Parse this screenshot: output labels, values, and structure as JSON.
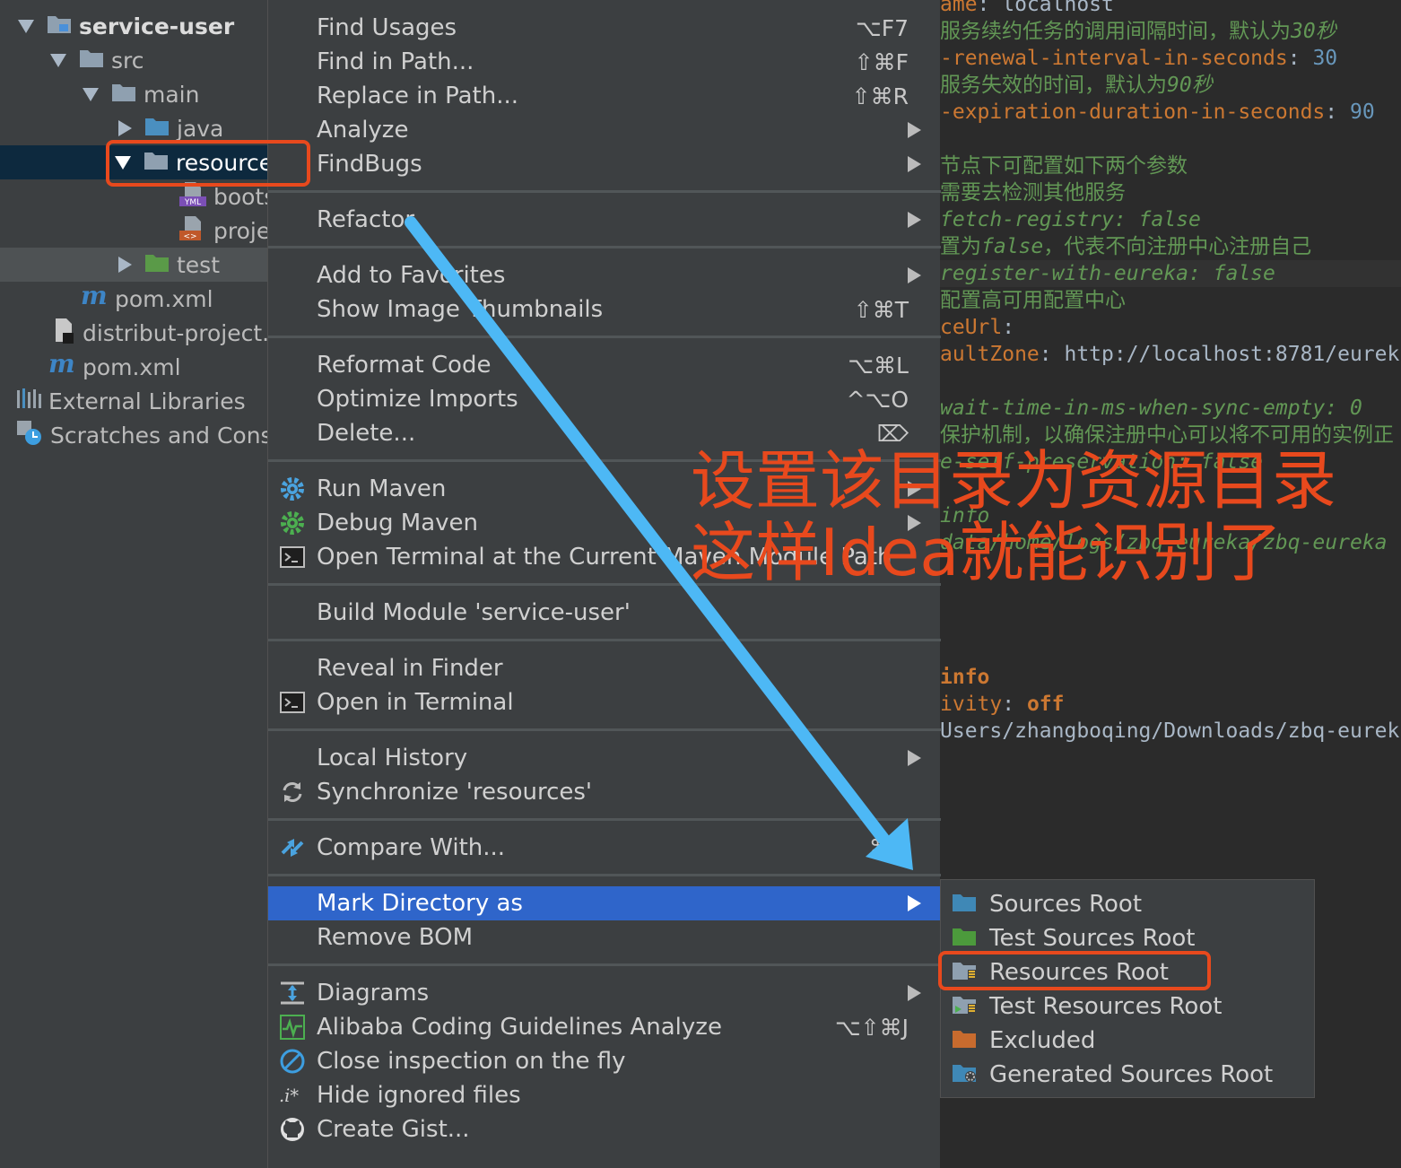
{
  "tree": {
    "items": [
      {
        "label": "service-user",
        "icon": "module-folder-icon"
      },
      {
        "label": "src",
        "icon": "folder-icon"
      },
      {
        "label": "main",
        "icon": "folder-icon"
      },
      {
        "label": "java",
        "icon": "source-folder-icon"
      },
      {
        "label": "resource",
        "icon": "folder-icon"
      },
      {
        "label": "boots",
        "icon": "yml-file-icon"
      },
      {
        "label": "proje",
        "icon": "properties-file-icon"
      },
      {
        "label": "test",
        "icon": "test-folder-icon"
      },
      {
        "label": "pom.xml",
        "icon": "maven-icon"
      },
      {
        "label": "distribut-project.",
        "icon": "file-icon"
      },
      {
        "label": "pom.xml",
        "icon": "maven-icon"
      },
      {
        "label": "External Libraries",
        "icon": "libraries-icon"
      },
      {
        "label": "Scratches and Cons",
        "icon": "scratches-icon"
      }
    ]
  },
  "editor": {
    "lines": [
      {
        "parts": [
          {
            "t": "ame",
            "c": "key"
          },
          {
            "t": ": localhost",
            "c": "plain"
          }
        ]
      },
      {
        "parts": [
          {
            "t": "服务续约任务的调用间隔时间，默认为",
            "c": "cmz"
          },
          {
            "t": "30秒",
            "c": "cm"
          }
        ]
      },
      {
        "parts": [
          {
            "t": "-renewal-interval-in-seconds",
            "c": "key"
          },
          {
            "t": ": ",
            "c": "plain"
          },
          {
            "t": "30",
            "c": "num"
          }
        ]
      },
      {
        "parts": [
          {
            "t": "服务失效的时间，默认为",
            "c": "cmz"
          },
          {
            "t": "90秒",
            "c": "cm"
          }
        ]
      },
      {
        "parts": [
          {
            "t": "-expiration-duration-in-seconds",
            "c": "key"
          },
          {
            "t": ": ",
            "c": "plain"
          },
          {
            "t": "90",
            "c": "num"
          }
        ]
      },
      {
        "parts": []
      },
      {
        "parts": [
          {
            "t": "节点下可配置如下两个参数",
            "c": "cmz"
          }
        ]
      },
      {
        "parts": [
          {
            "t": "需要去检测其他服务",
            "c": "cmz"
          }
        ]
      },
      {
        "parts": [
          {
            "t": "fetch-registry: false",
            "c": "cm"
          }
        ]
      },
      {
        "parts": [
          {
            "t": "置为",
            "c": "cmz"
          },
          {
            "t": "false",
            "c": "cm"
          },
          {
            "t": "，代表不向注册中心注册自己",
            "c": "cmz"
          }
        ]
      },
      {
        "parts": [
          {
            "t": "register-with-eureka: false",
            "c": "cm"
          }
        ],
        "hl": true
      },
      {
        "parts": [
          {
            "t": "配置高可用配置中心",
            "c": "cmz"
          }
        ]
      },
      {
        "parts": [
          {
            "t": "ceUrl",
            "c": "key"
          },
          {
            "t": ":",
            "c": "plain"
          }
        ]
      },
      {
        "parts": [
          {
            "t": "aultZone",
            "c": "key"
          },
          {
            "t": ": http://localhost:8781/eurek",
            "c": "plain"
          }
        ]
      },
      {
        "parts": []
      },
      {
        "parts": [
          {
            "t": "wait-time-in-ms-when-sync-empty: 0",
            "c": "cm"
          }
        ]
      },
      {
        "parts": [
          {
            "t": "保护机制，以确保注册中心可以将不可用的实例正",
            "c": "cmz"
          }
        ]
      },
      {
        "parts": [
          {
            "t": "e-self-preservation: false",
            "c": "cm"
          }
        ]
      },
      {
        "parts": []
      },
      {
        "parts": [
          {
            "t": "info",
            "c": "cm"
          }
        ]
      },
      {
        "parts": [
          {
            "t": "data/home/logs/zbq-eureka/zbq-eureka",
            "c": "cm"
          }
        ]
      },
      {
        "parts": []
      },
      {
        "parts": []
      },
      {
        "parts": []
      },
      {
        "parts": []
      },
      {
        "parts": [
          {
            "t": " info",
            "c": "kw"
          }
        ]
      },
      {
        "parts": [
          {
            "t": "ivity",
            "c": "key"
          },
          {
            "t": ": ",
            "c": "plain"
          },
          {
            "t": "off",
            "c": "kw"
          }
        ]
      },
      {
        "parts": [
          {
            "t": "Users/zhangboqing/Downloads/zbq-eurek",
            "c": "plain"
          }
        ]
      }
    ]
  },
  "menu": {
    "groups": [
      [
        {
          "label": "Find Usages",
          "shortcut": "⌥F7"
        },
        {
          "label": "Find in Path...",
          "shortcut": "⇧⌘F"
        },
        {
          "label": "Replace in Path...",
          "shortcut": "⇧⌘R"
        },
        {
          "label": "Analyze",
          "submenu": true
        },
        {
          "label": "FindBugs",
          "submenu": true
        }
      ],
      [
        {
          "label": "Refactor",
          "submenu": true
        }
      ],
      [
        {
          "label": "Add to Favorites",
          "submenu": true
        },
        {
          "label": "Show Image Thumbnails",
          "shortcut": "⇧⌘T"
        }
      ],
      [
        {
          "label": "Reformat Code",
          "shortcut": "⌥⌘L"
        },
        {
          "label": "Optimize Imports",
          "shortcut": "^⌥O"
        },
        {
          "label": "Delete...",
          "shortcut": "⌦"
        }
      ],
      [
        {
          "label": "Run Maven",
          "submenu": true,
          "icon": "gear-icon"
        },
        {
          "label": "Debug Maven",
          "submenu": true,
          "icon": "debug-gear-icon"
        },
        {
          "label": "Open Terminal at the Current Maven Module Path",
          "icon": "terminal-icon"
        }
      ],
      [
        {
          "label": "Build Module 'service-user'"
        }
      ],
      [
        {
          "label": "Reveal in Finder"
        },
        {
          "label": "Open in Terminal",
          "icon": "terminal-icon"
        }
      ],
      [
        {
          "label": "Local History",
          "submenu": true
        },
        {
          "label": "Synchronize 'resources'",
          "icon": "sync-icon"
        }
      ],
      [
        {
          "label": "Compare With...",
          "icon": "compare-icon",
          "shortcut": "⌘D"
        }
      ],
      [
        {
          "label": "Mark Directory as",
          "submenu": true,
          "active": true
        },
        {
          "label": "Remove BOM"
        }
      ],
      [
        {
          "label": "Diagrams",
          "submenu": true,
          "icon": "diagram-icon"
        },
        {
          "label": "Alibaba Coding Guidelines Analyze",
          "shortcut": "⌥⇧⌘J",
          "icon": "analyze-icon"
        },
        {
          "label": "Close inspection on the fly",
          "icon": "no-entry-icon"
        },
        {
          "label": "Hide ignored files",
          "icon": "ignored-files-icon"
        },
        {
          "label": "Create Gist...",
          "icon": "github-icon"
        }
      ]
    ]
  },
  "submenu": {
    "items": [
      {
        "label": "Sources Root",
        "icon": "sources-root-icon"
      },
      {
        "label": "Test Sources Root",
        "icon": "test-sources-root-icon"
      },
      {
        "label": "Resources Root",
        "icon": "resources-root-icon"
      },
      {
        "label": "Test Resources Root",
        "icon": "test-resources-root-icon"
      },
      {
        "label": "Excluded",
        "icon": "excluded-folder-icon"
      },
      {
        "label": "Generated Sources Root",
        "icon": "generated-sources-root-icon"
      }
    ]
  },
  "annotation": {
    "line1": "设置该目录为资源目录",
    "line2": "这样Idea就能识别了"
  },
  "colors": {
    "highlight": "#2f65ca",
    "annotation_red": "#e8491d",
    "arrow_blue": "#4db8f5"
  }
}
